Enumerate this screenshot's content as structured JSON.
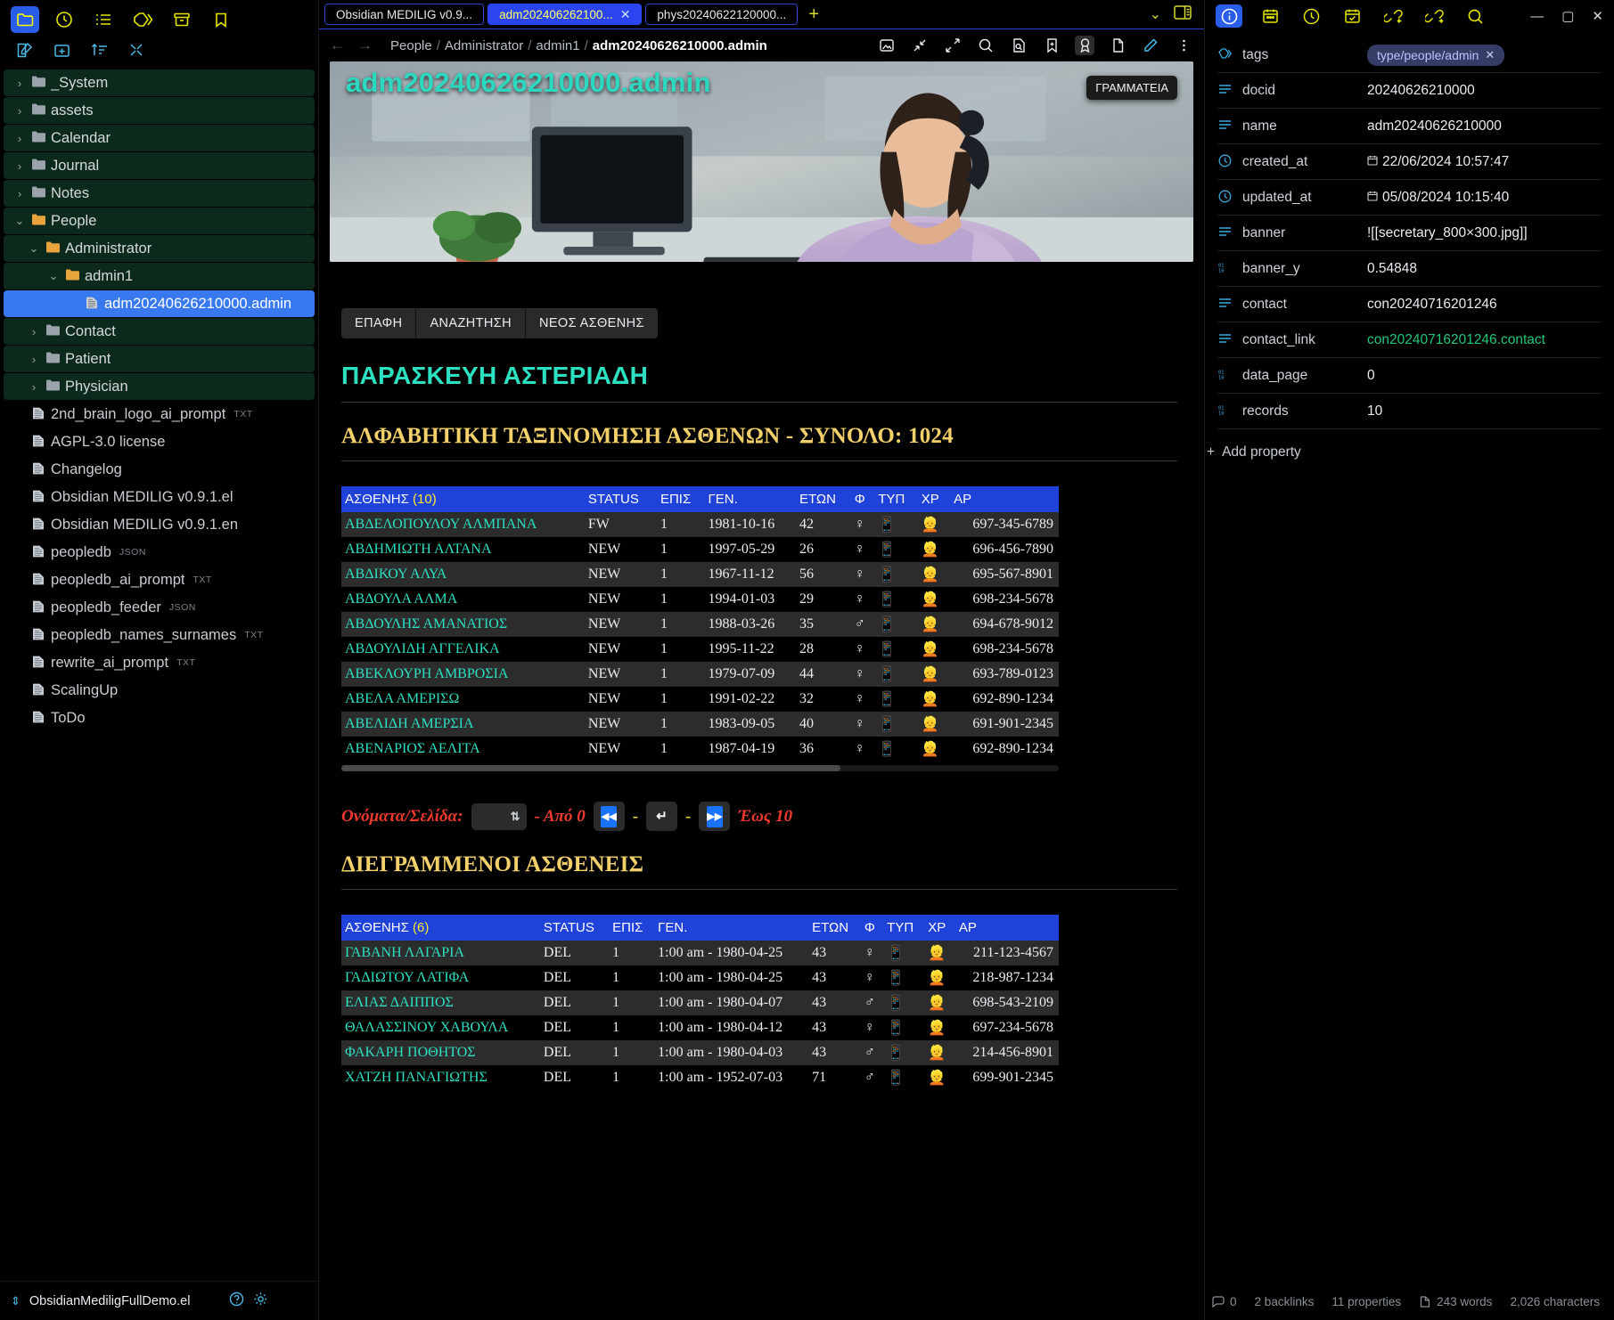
{
  "sidebar": {
    "top_icons": [
      {
        "name": "folder-icon",
        "active": true
      },
      {
        "name": "clock-icon",
        "active": false
      },
      {
        "name": "list-icon",
        "active": false
      },
      {
        "name": "tag-icon",
        "active": false
      },
      {
        "name": "archive-icon",
        "active": false
      },
      {
        "name": "bookmark-icon",
        "active": false
      }
    ],
    "tools": [
      "new-note-icon",
      "new-folder-icon",
      "sort-icon",
      "collapse-icon"
    ],
    "tree": [
      {
        "label": "_System",
        "type": "folder",
        "indent": 0,
        "expanded": false
      },
      {
        "label": "assets",
        "type": "folder",
        "indent": 0,
        "expanded": false
      },
      {
        "label": "Calendar",
        "type": "folder",
        "indent": 0,
        "expanded": false
      },
      {
        "label": "Journal",
        "type": "folder",
        "indent": 0,
        "expanded": false
      },
      {
        "label": "Notes",
        "type": "folder",
        "indent": 0,
        "expanded": false
      },
      {
        "label": "People",
        "type": "folder",
        "indent": 0,
        "expanded": true
      },
      {
        "label": "Administrator",
        "type": "folder",
        "indent": 1,
        "expanded": true
      },
      {
        "label": "admin1",
        "type": "folder",
        "indent": 2,
        "expanded": true
      },
      {
        "label": "adm20240626210000.admin",
        "type": "file",
        "indent": 3,
        "selected": true
      },
      {
        "label": "Contact",
        "type": "folder",
        "indent": 1,
        "expanded": false
      },
      {
        "label": "Patient",
        "type": "folder",
        "indent": 1,
        "expanded": false
      },
      {
        "label": "Physician",
        "type": "folder",
        "indent": 1,
        "expanded": false
      },
      {
        "label": "2nd_brain_logo_ai_prompt",
        "type": "file",
        "indent": 0,
        "ext": "TXT"
      },
      {
        "label": "AGPL-3.0 license",
        "type": "file",
        "indent": 0,
        "ext": ""
      },
      {
        "label": "Changelog",
        "type": "file",
        "indent": 0,
        "ext": ""
      },
      {
        "label": "Obsidian MEDILIG v0.9.1.el",
        "type": "file",
        "indent": 0,
        "ext": ""
      },
      {
        "label": "Obsidian MEDILIG v0.9.1.en",
        "type": "file",
        "indent": 0,
        "ext": ""
      },
      {
        "label": "peopledb",
        "type": "file",
        "indent": 0,
        "ext": "JSON"
      },
      {
        "label": "peopledb_ai_prompt",
        "type": "file",
        "indent": 0,
        "ext": "TXT"
      },
      {
        "label": "peopledb_feeder",
        "type": "file",
        "indent": 0,
        "ext": "JSON"
      },
      {
        "label": "peopledb_names_surnames",
        "type": "file",
        "indent": 0,
        "ext": "TXT"
      },
      {
        "label": "rewrite_ai_prompt",
        "type": "file",
        "indent": 0,
        "ext": "TXT"
      },
      {
        "label": "ScalingUp",
        "type": "file",
        "indent": 0,
        "ext": ""
      },
      {
        "label": "ToDo",
        "type": "file",
        "indent": 0,
        "ext": ""
      }
    ],
    "vault_name": "ObsidianMediligFullDemo.el"
  },
  "tabs": [
    {
      "label": "Obsidian MEDILIG v0.9...",
      "active": false,
      "closable": false
    },
    {
      "label": "adm202406262100...",
      "active": true,
      "closable": true
    },
    {
      "label": "phys20240622120000...",
      "active": false,
      "closable": false
    }
  ],
  "tab_add_label": "+",
  "breadcrumb": {
    "parts": [
      "People",
      "Administrator",
      "admin1"
    ],
    "current": "adm20240626210000.admin"
  },
  "banner": {
    "title": "adm20240626210000.admin",
    "tooltip": "ΓΡΑΜΜΑΤΕΙΑ"
  },
  "main": {
    "buttons": [
      "ΕΠΑΦΗ",
      "ΑΝΑΖΗΤΗΣΗ",
      "ΝΕΟΣ ΑΣΘΕΝΗΣ"
    ],
    "person_name": "ΠΑΡΑΣΚΕΥΗ ΑΣΤΕΡΙΑΔΗ",
    "section1_title": "ΑΛΦΑΒΗΤΙΚΗ ΤΑΞΙΝΟΜΗΣΗ ΑΣΘΕΝΩΝ - ΣΥΝΟΛΟ: 1024",
    "section2_title": "ΔΙΕΓΡΑΜΜΕΝΟΙ ΑΣΘΕΝΕΙΣ",
    "pager": {
      "label": "Ονόματα/Σελίδα:",
      "select_value": "",
      "from_label": "- Από 0",
      "first_icon": "⏪",
      "reload_icon": "↵",
      "last_icon": "⏩",
      "to_label": "Έως 10",
      "sep": "-"
    }
  },
  "table1": {
    "count": "(10)",
    "headers": [
      "ΑΣΘΕΝΗΣ",
      "STATUS",
      "ΕΠΙΣ",
      "ΓΕΝ.",
      "ΕΤΩΝ",
      "Φ",
      "ΤΥΠ",
      "ΧΡ",
      "ΑΡ"
    ],
    "rows": [
      {
        "name": "ΑΒΔΕΛΟΠΟΥΛΟΥ ΑΛΜΠΑΝΑ",
        "status": "FW",
        "epis": "1",
        "born": "1981-10-16",
        "age": "42",
        "sex": "♀",
        "typ": "📱",
        "chr": "👱",
        "ar": "697-345-6789"
      },
      {
        "name": "ΑΒΔΗΜΙΩΤΗ ΑΛΤΑΝΑ",
        "status": "NEW",
        "epis": "1",
        "born": "1997-05-29",
        "age": "26",
        "sex": "♀",
        "typ": "📱",
        "chr": "👱",
        "ar": "696-456-7890"
      },
      {
        "name": "ΑΒΔΙΚΟΥ ΑΛΥΑ",
        "status": "NEW",
        "epis": "1",
        "born": "1967-11-12",
        "age": "56",
        "sex": "♀",
        "typ": "📱",
        "chr": "👱",
        "ar": "695-567-8901"
      },
      {
        "name": "ΑΒΔΟΥΛΑ ΑΛΜΑ",
        "status": "NEW",
        "epis": "1",
        "born": "1994-01-03",
        "age": "29",
        "sex": "♀",
        "typ": "📱",
        "chr": "👱",
        "ar": "698-234-5678"
      },
      {
        "name": "ΑΒΔΟΥΛΗΣ ΑΜΑΝΑΤΙΟΣ",
        "status": "NEW",
        "epis": "1",
        "born": "1988-03-26",
        "age": "35",
        "sex": "♂",
        "typ": "📱",
        "chr": "👱",
        "ar": "694-678-9012"
      },
      {
        "name": "ΑΒΔΟΥΛΙΔΗ ΑΓΓΕΛΙΚΑ",
        "status": "NEW",
        "epis": "1",
        "born": "1995-11-22",
        "age": "28",
        "sex": "♀",
        "typ": "📱",
        "chr": "👱",
        "ar": "698-234-5678"
      },
      {
        "name": "ΑΒΕΚΛΟΥΡΗ ΑΜΒΡΟΣΙΑ",
        "status": "NEW",
        "epis": "1",
        "born": "1979-07-09",
        "age": "44",
        "sex": "♀",
        "typ": "📱",
        "chr": "👱",
        "ar": "693-789-0123"
      },
      {
        "name": "ΑΒΕΛΑ ΑΜΕΡΙΣΩ",
        "status": "NEW",
        "epis": "1",
        "born": "1991-02-22",
        "age": "32",
        "sex": "♀",
        "typ": "📱",
        "chr": "👱",
        "ar": "692-890-1234"
      },
      {
        "name": "ΑΒΕΛΙΔΗ ΑΜΕΡΣΙΑ",
        "status": "NEW",
        "epis": "1",
        "born": "1983-09-05",
        "age": "40",
        "sex": "♀",
        "typ": "📱",
        "chr": "👱",
        "ar": "691-901-2345"
      },
      {
        "name": "ΑΒΕΝΑΡΙΟΣ ΑΕΛΙΤΑ",
        "status": "NEW",
        "epis": "1",
        "born": "1987-04-19",
        "age": "36",
        "sex": "♀",
        "typ": "📱",
        "chr": "👱",
        "ar": "692-890-1234"
      }
    ]
  },
  "table2": {
    "count": "(6)",
    "headers": [
      "ΑΣΘΕΝΗΣ",
      "STATUS",
      "ΕΠΙΣ",
      "ΓΕΝ.",
      "ΕΤΩΝ",
      "Φ",
      "ΤΥΠ",
      "ΧΡ",
      "ΑΡ"
    ],
    "rows": [
      {
        "name": "ΓΑΒΑΝΗ ΛΑΓΑΡΙΑ",
        "status": "DEL",
        "epis": "1",
        "born": "1:00 am - 1980-04-25",
        "age": "43",
        "sex": "♀",
        "typ": "📱",
        "chr": "👱",
        "ar": "211-123-4567"
      },
      {
        "name": "ΓΑΔΙΩΤΟΥ ΛΑΤΙΦΑ",
        "status": "DEL",
        "epis": "1",
        "born": "1:00 am - 1980-04-25",
        "age": "43",
        "sex": "♀",
        "typ": "📱",
        "chr": "👱",
        "ar": "218-987-1234"
      },
      {
        "name": "ΕΛΙΑΣ ΔΑΙΠΠΟΣ",
        "status": "DEL",
        "epis": "1",
        "born": "1:00 am - 1980-04-07",
        "age": "43",
        "sex": "♂",
        "typ": "📱",
        "chr": "👱",
        "ar": "698-543-2109"
      },
      {
        "name": "ΘΑΛΑΣΣΙΝΟΥ ΧΑΒΟΥΛΑ",
        "status": "DEL",
        "epis": "1",
        "born": "1:00 am - 1980-04-12",
        "age": "43",
        "sex": "♀",
        "typ": "📱",
        "chr": "👱",
        "ar": "697-234-5678"
      },
      {
        "name": "ΦΑΚΑΡΗ ΠΟΘΗΤΟΣ",
        "status": "DEL",
        "epis": "1",
        "born": "1:00 am - 1980-04-03",
        "age": "43",
        "sex": "♂",
        "typ": "📱",
        "chr": "👱",
        "ar": "214-456-8901"
      },
      {
        "name": "ΧΑΤΖΗ ΠΑΝΑΓΙΩΤΗΣ",
        "status": "DEL",
        "epis": "1",
        "born": "1:00 am - 1952-07-03",
        "age": "71",
        "sex": "♂",
        "typ": "📱",
        "chr": "👱",
        "ar": "699-901-2345"
      }
    ]
  },
  "rightpane": {
    "icons": [
      "info-icon",
      "calendar-icon",
      "clock-icon",
      "calendar-check-icon",
      "link-back-icon",
      "link-forward-icon",
      "search-icon"
    ],
    "window_controls": [
      "minimize-icon",
      "maximize-icon",
      "close-icon"
    ],
    "properties": [
      {
        "key": "tags",
        "icon": "tag-icon",
        "value": "type/people/admin",
        "kind": "chip"
      },
      {
        "key": "docid",
        "icon": "text-icon",
        "value": "20240626210000",
        "kind": "text"
      },
      {
        "key": "name",
        "icon": "text-icon",
        "value": "adm20240626210000",
        "kind": "text"
      },
      {
        "key": "created_at",
        "icon": "clock-icon",
        "value": "22/06/2024 10:57:47",
        "kind": "date"
      },
      {
        "key": "updated_at",
        "icon": "clock-icon",
        "value": "05/08/2024 10:15:40",
        "kind": "date"
      },
      {
        "key": "banner",
        "icon": "text-icon",
        "value": "![[secretary_800×300.jpg]]",
        "kind": "text"
      },
      {
        "key": "banner_y",
        "icon": "number-icon",
        "value": "0.54848",
        "kind": "text"
      },
      {
        "key": "contact",
        "icon": "text-icon",
        "value": "con20240716201246",
        "kind": "text"
      },
      {
        "key": "contact_link",
        "icon": "text-icon",
        "value": "con20240716201246.contact",
        "kind": "link"
      },
      {
        "key": "data_page",
        "icon": "number-icon",
        "value": "0",
        "kind": "text"
      },
      {
        "key": "records",
        "icon": "number-icon",
        "value": "10",
        "kind": "text"
      }
    ],
    "add_property": "Add property",
    "status": {
      "comments": "0",
      "backlinks": "2 backlinks",
      "properties": "11 properties",
      "words": "243 words",
      "characters": "2,026 characters"
    }
  },
  "colors": {
    "accent_blue": "#2a45ef",
    "header_blue": "#1f43d9",
    "teal": "#2ce0c2",
    "gold": "#f3d06a",
    "red": "#f0392b",
    "green_link": "#22c779",
    "folder_row": "#0b2a1b"
  }
}
